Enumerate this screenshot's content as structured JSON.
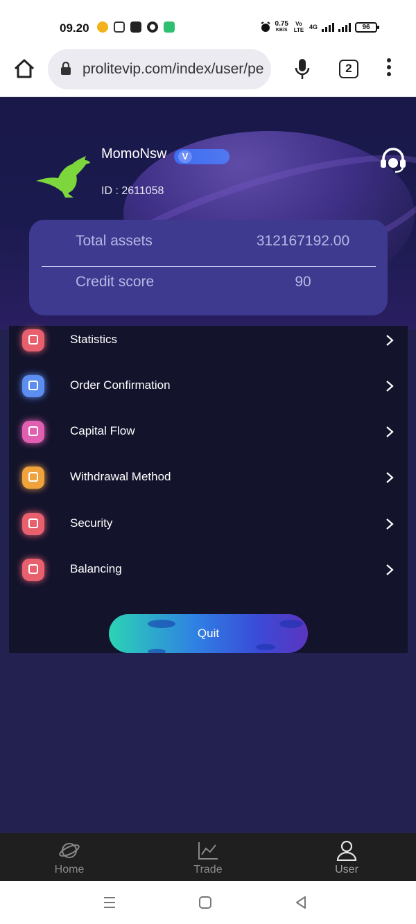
{
  "status_bar": {
    "time": "09.20",
    "net_speed": "0.75",
    "net_unit": "KB/S",
    "volte": "Vo LTE",
    "network": "4G",
    "battery": "96"
  },
  "browser": {
    "url": "prolitevip.com/index/user/pe",
    "tab_count": "2"
  },
  "profile": {
    "username": "MomoNsw",
    "vip_label": "V",
    "user_id": "ID : 2611058"
  },
  "assets": {
    "total_label": "Total assets",
    "total_value": "312167192.00",
    "credit_label": "Credit score",
    "credit_value": "90"
  },
  "menu": {
    "items": [
      {
        "label": "Statistics",
        "icon": "chart-icon",
        "color": "#e8606e"
      },
      {
        "label": "Order Confirmation",
        "icon": "clipboard-icon",
        "color": "#5b8ef0"
      },
      {
        "label": "Capital Flow",
        "icon": "document-icon",
        "color": "#e05fb0"
      },
      {
        "label": "Withdrawal Method",
        "icon": "wallet-icon",
        "color": "#f0a23c"
      },
      {
        "label": "Security",
        "icon": "shield-icon",
        "color": "#e8606e"
      },
      {
        "label": "Balancing",
        "icon": "chart-icon",
        "color": "#e8606e"
      }
    ]
  },
  "quit_label": "Quit",
  "bottom_nav": {
    "home": "Home",
    "trade": "Trade",
    "user": "User"
  },
  "colors": {
    "background": "#22214f",
    "panel": "#13132c",
    "card": "#3d3a90",
    "accent": "#3f6df0"
  }
}
